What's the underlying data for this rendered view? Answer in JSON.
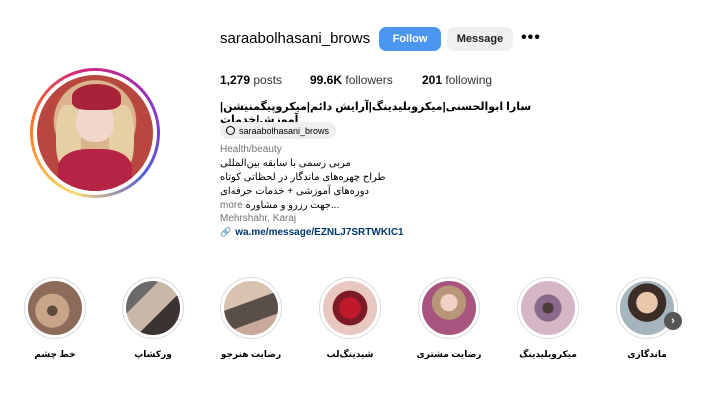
{
  "profile": {
    "username": "saraabolhasani_brows",
    "follow_label": "Follow",
    "message_label": "Message",
    "more_label": "•••",
    "posts_count": "1,279",
    "posts_label": "posts",
    "followers_count": "99.6K",
    "followers_label": "followers",
    "following_count": "201",
    "following_label": "following",
    "full_name": "سارا ابوالحسنی|میکروبلیدینگ|آرایش دائم|میکروپیگمنیشن|آموزش|خدمات",
    "threads_handle": "saraabolhasani_brows",
    "category": "Health/beauty",
    "bio_lines": [
      "مربی رسمی با سابقه بین‌المللی",
      "طراح چهره‌های ماندگار در لحظاتی کوتاه",
      "دوره‌های آموزشی + خدمات حرفه‌ای",
      "...جهت رزرو و مشاوره"
    ],
    "bio_more": "more",
    "location": "Mehrshahr, Karaj",
    "link": "wa.me/message/EZNLJ7SRTWKIC1"
  },
  "highlights": [
    {
      "label": "خط چشم",
      "icon": "eyeliner-photo"
    },
    {
      "label": "ورکشاپ",
      "icon": "workshop-photo"
    },
    {
      "label": "رضایت هنرجو",
      "icon": "student-satisfaction-photo"
    },
    {
      "label": "شیدینگ‌لب",
      "icon": "lip-shading-photo"
    },
    {
      "label": "رضایت مشتری",
      "icon": "customer-satisfaction-photo"
    },
    {
      "label": "میکروبلیدینگ",
      "icon": "microblading-photo"
    },
    {
      "label": "ماندگاری",
      "icon": "durability-photo"
    }
  ],
  "colors": {
    "follow_button": "#4a96f0",
    "message_button": "#efefef",
    "link": "#00376b",
    "secondary_text": "#737373"
  }
}
